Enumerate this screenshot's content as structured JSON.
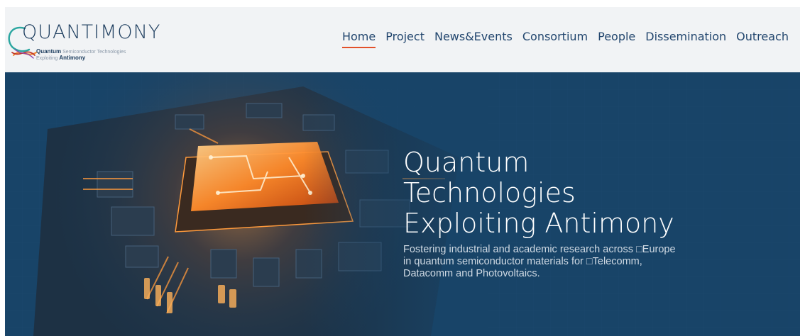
{
  "logo": {
    "wordmark": "QUANTIMONY",
    "tagline_bold_1": "Quantum",
    "tagline_rest_1": "Semiconductor Technologies",
    "tagline_rest_2": "Exploiting",
    "tagline_bold_2": "Antimony"
  },
  "nav": {
    "items": [
      {
        "label": "Home",
        "active": true
      },
      {
        "label": "Project"
      },
      {
        "label": "News&Events"
      },
      {
        "label": "Consortium"
      },
      {
        "label": "People"
      },
      {
        "label": "Dissemination"
      },
      {
        "label": "Outreach"
      }
    ]
  },
  "hero": {
    "title_lines": [
      "Quantum",
      "Technologies",
      "Exploiting Antimony"
    ],
    "subtitle_lines": [
      "Fostering industrial and academic research across □Europe",
      "in quantum semiconductor materials for □Telecomm,",
      "Datacomm and Photovoltaics."
    ]
  },
  "colors": {
    "header_bg": "#f1f3f5",
    "hero_bg": "#184468",
    "nav_text": "#22466e",
    "active_underline": "#e2502a",
    "chip_glow": "#ff8a2a"
  }
}
